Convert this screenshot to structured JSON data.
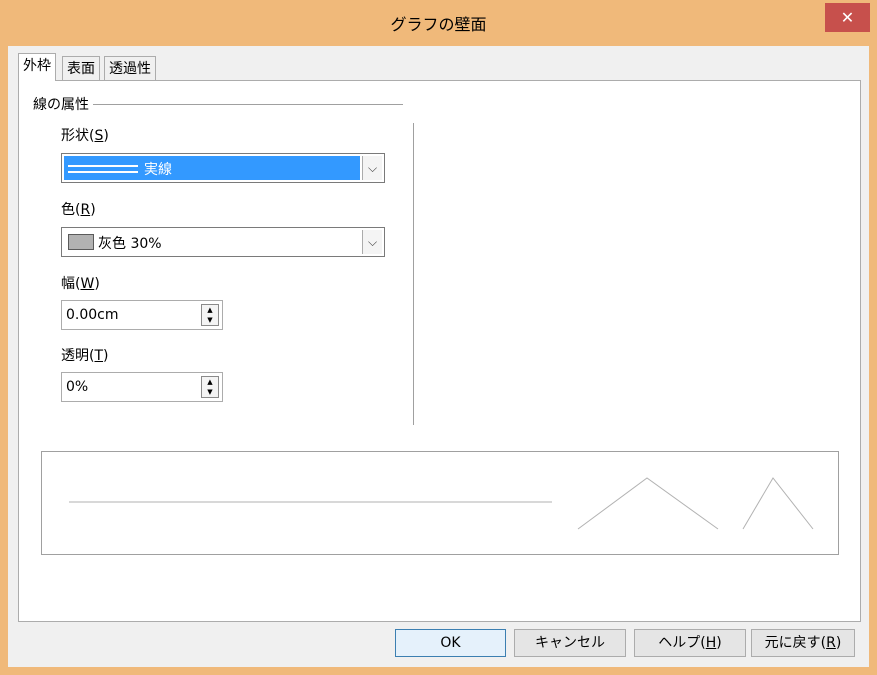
{
  "window": {
    "title": "グラフの壁面",
    "close_glyph": "✕"
  },
  "tabs": [
    {
      "label": "外枠",
      "active": true
    },
    {
      "label": "表面",
      "active": false
    },
    {
      "label": "透過性",
      "active": false
    }
  ],
  "group": {
    "title": "線の属性"
  },
  "fields": {
    "style": {
      "label": "形状(",
      "mnemonic": "S",
      "label_end": ")",
      "value": "実線"
    },
    "color": {
      "label": "色(",
      "mnemonic": "R",
      "label_end": ")",
      "value": "灰色 30%",
      "swatch": "#b2b2b2"
    },
    "width": {
      "label": "幅(",
      "mnemonic": "W",
      "label_end": ")",
      "value": "0.00cm"
    },
    "transparency": {
      "label": "透明(",
      "mnemonic": "T",
      "label_end": ")",
      "value": "0%"
    }
  },
  "buttons": {
    "ok": "OK",
    "cancel": "キャンセル",
    "help": {
      "label": "ヘルプ(",
      "mnemonic": "H",
      "label_end": ")"
    },
    "reset": {
      "label": "元に戻す(",
      "mnemonic": "R",
      "label_end": ")"
    }
  },
  "colors": {
    "frame": "#f0b97a",
    "close_button": "#c7504c",
    "selection": "#3399ff"
  }
}
